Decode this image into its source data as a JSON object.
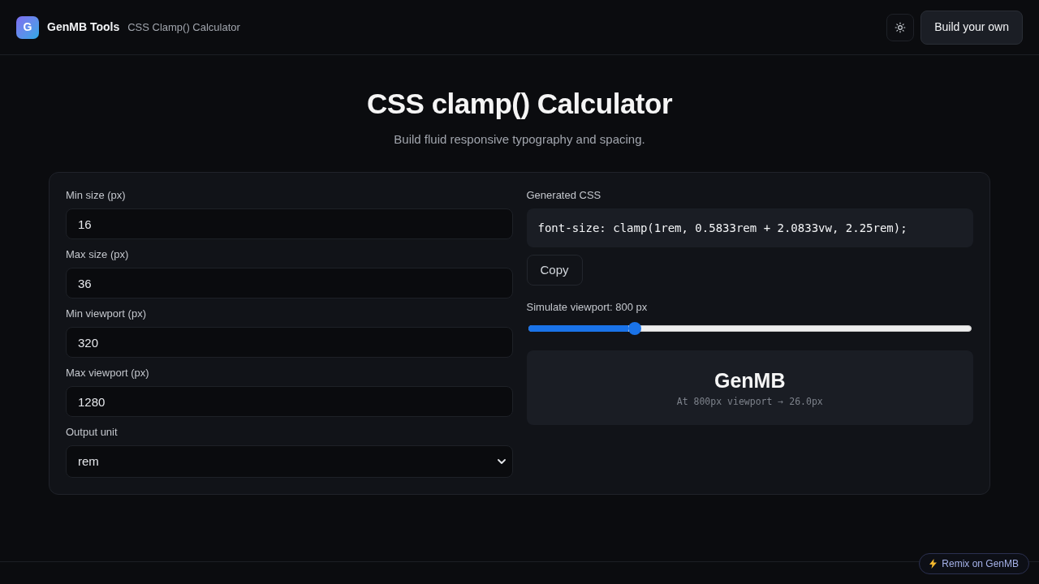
{
  "header": {
    "logo_letter": "G",
    "brand": "GenMB Tools",
    "page_title": "CSS Clamp() Calculator",
    "build_button": "Build your own"
  },
  "hero": {
    "title": "CSS clamp() Calculator",
    "subtitle": "Build fluid responsive typography and spacing."
  },
  "inputs": [
    {
      "kind": "number",
      "label": "Min size (px)",
      "value": "16"
    },
    {
      "kind": "number",
      "label": "Max size (px)",
      "value": "36"
    },
    {
      "kind": "number",
      "label": "Min viewport (px)",
      "value": "320"
    },
    {
      "kind": "number",
      "label": "Max viewport (px)",
      "value": "1280"
    },
    {
      "kind": "select",
      "label": "Output unit",
      "value": "rem"
    }
  ],
  "output": {
    "label": "Generated CSS",
    "code": "font-size: clamp(1rem, 0.5833rem + 2.0833vw, 2.25rem);",
    "copy_button": "Copy"
  },
  "simulator": {
    "label": "Simulate viewport: 800 px",
    "level": 0.24
  },
  "preview": {
    "sample": "GenMB",
    "caption": "At 800px viewport → 26.0px"
  },
  "footer": {
    "remix_badge": "Remix on GenMB"
  }
}
